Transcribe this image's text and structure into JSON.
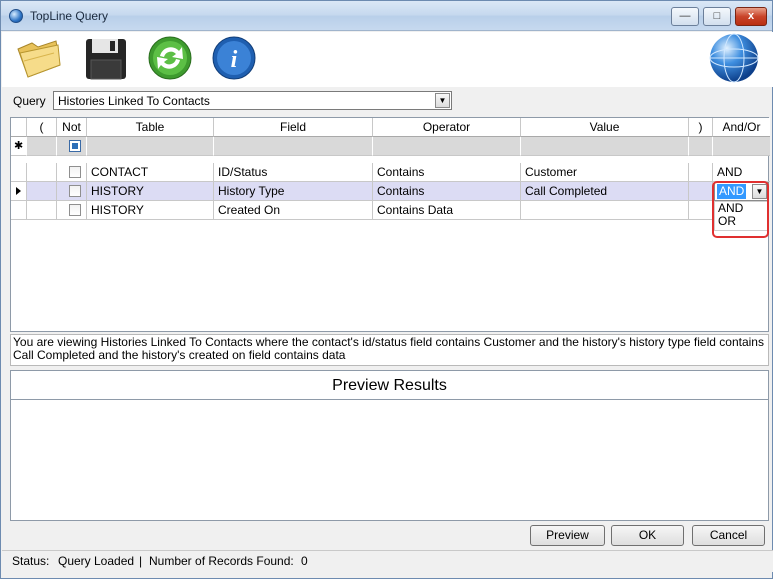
{
  "window": {
    "title": "TopLine Query",
    "min_glyph": "—",
    "max_glyph": "□",
    "close_glyph": "x"
  },
  "toolbar": {
    "icons": [
      "open-folder-icon",
      "save-disk-icon",
      "refresh-icon",
      "info-icon",
      "globe-icon"
    ],
    "info_glyph": "i"
  },
  "query": {
    "label": "Query",
    "value": "Histories Linked To Contacts"
  },
  "grid": {
    "headers": {
      "open_paren": "(",
      "not": "Not",
      "table": "Table",
      "field": "Field",
      "operator": "Operator",
      "value": "Value",
      "close_paren": ")",
      "andor": "And/Or"
    },
    "new_row_glyph": "✱",
    "rows": [
      {
        "table": "CONTACT",
        "field": "ID/Status",
        "operator": "Contains",
        "value": "Customer",
        "andor": "AND"
      },
      {
        "table": "HISTORY",
        "field": "History Type",
        "operator": "Contains",
        "value": "Call Completed",
        "andor": "AND"
      },
      {
        "table": "HISTORY",
        "field": "Created On",
        "operator": "Contains Data",
        "value": "",
        "andor": ""
      }
    ],
    "andor_dropdown": {
      "selected": "AND",
      "options": [
        "AND",
        "OR"
      ]
    }
  },
  "description": "You are viewing Histories Linked To Contacts where the contact's id/status field contains Customer and the history's history type field contains Call Completed and the history's created on field contains data",
  "preview": {
    "title": "Preview Results"
  },
  "buttons": {
    "preview": "Preview",
    "ok": "OK",
    "cancel": "Cancel"
  },
  "status": {
    "label": "Status:",
    "value": "Query Loaded",
    "sep": "|",
    "records_label": "Number of Records Found:",
    "records_value": "0"
  }
}
